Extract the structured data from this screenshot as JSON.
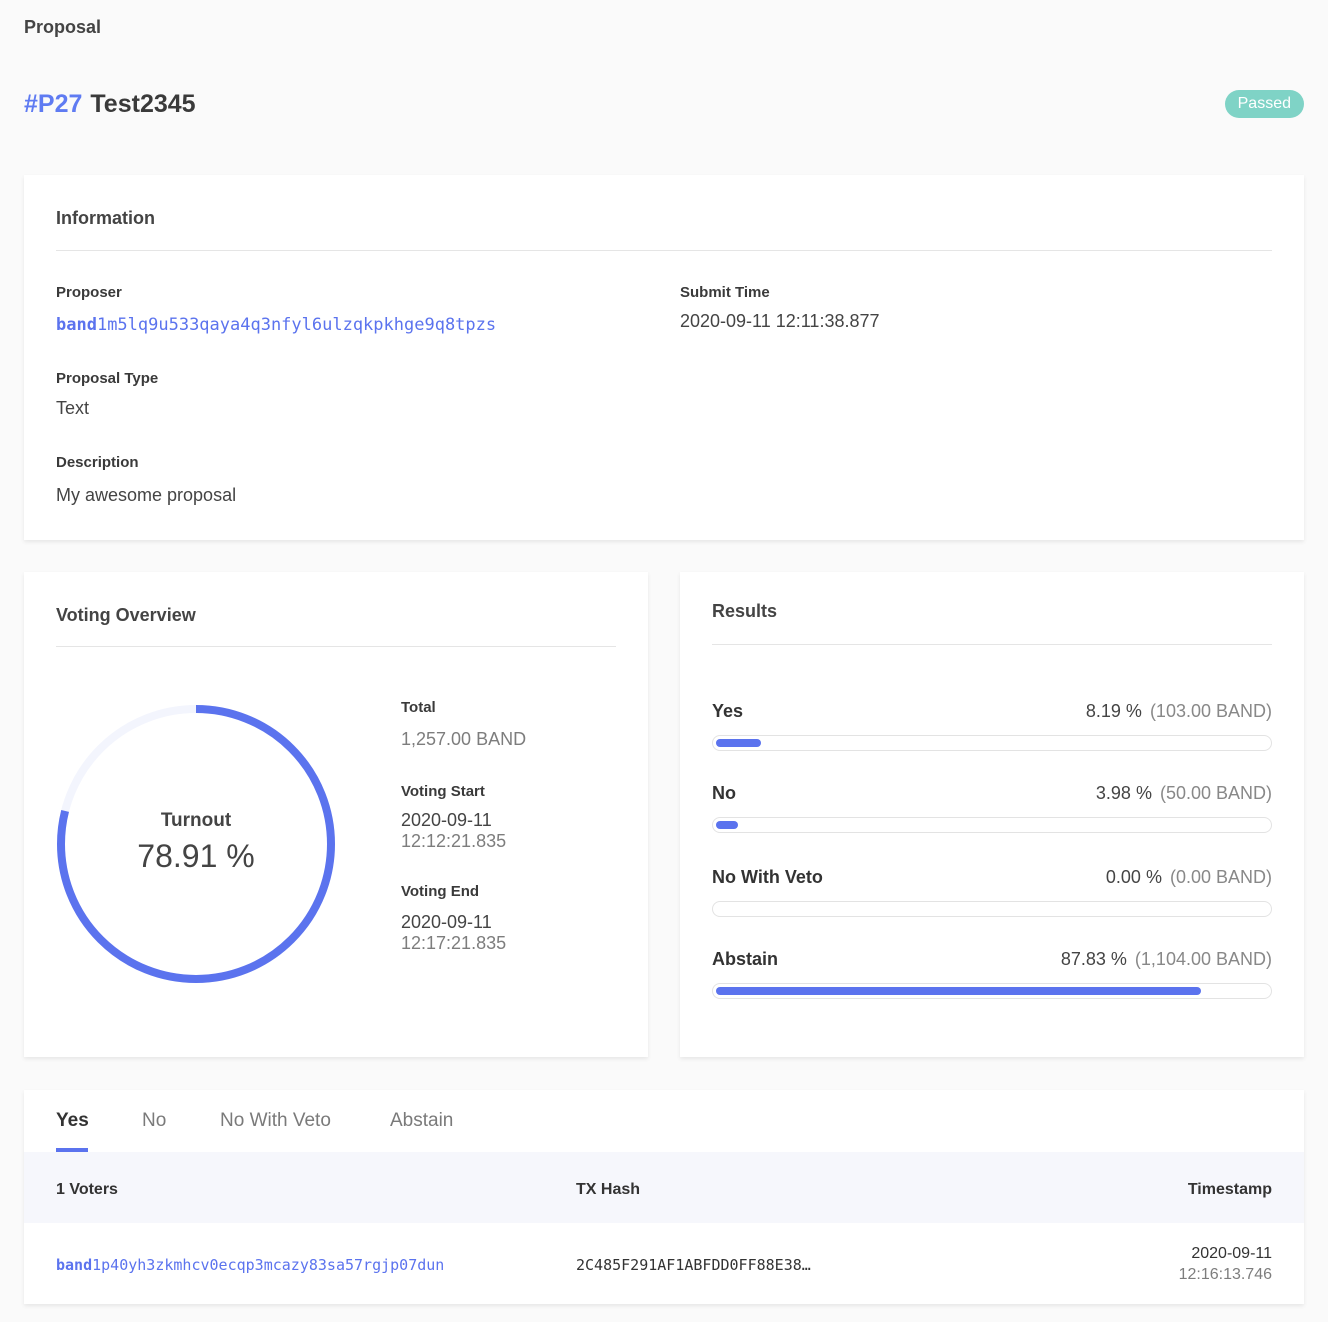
{
  "page_label": "Proposal",
  "proposal": {
    "id": "#P27",
    "name": "Test2345",
    "status": "Passed"
  },
  "information": {
    "title": "Information",
    "proposer_label": "Proposer",
    "proposer_prefix": "band",
    "proposer_rest": "1m5lq9u533qaya4q3nfyl6ulzqkpkhge9q8tpzs",
    "submit_time_label": "Submit Time",
    "submit_time": "2020-09-11 12:11:38.877",
    "proposal_type_label": "Proposal Type",
    "proposal_type": "Text",
    "description_label": "Description",
    "description": "My awesome proposal"
  },
  "voting_overview": {
    "title": "Voting Overview",
    "turnout_label": "Turnout",
    "turnout_value": "78.91 %",
    "turnout_fraction": 0.7891,
    "total_label": "Total",
    "total_value": "1,257.00 BAND",
    "voting_start_label": "Voting Start",
    "voting_start_date": "2020-09-11",
    "voting_start_time": "12:12:21.835",
    "voting_end_label": "Voting End",
    "voting_end_date": "2020-09-11",
    "voting_end_time": "12:17:21.835"
  },
  "results": {
    "title": "Results",
    "rows": [
      {
        "name": "Yes",
        "percent": "8.19 %",
        "amount": "(103.00 BAND)",
        "fraction": 0.0819
      },
      {
        "name": "No",
        "percent": "3.98 %",
        "amount": "(50.00 BAND)",
        "fraction": 0.0398
      },
      {
        "name": "No With Veto",
        "percent": "0.00 %",
        "amount": "(0.00 BAND)",
        "fraction": 0.0
      },
      {
        "name": "Abstain",
        "percent": "87.83 %",
        "amount": "(1,104.00 BAND)",
        "fraction": 0.8783
      }
    ]
  },
  "votes_table": {
    "tabs": [
      "Yes",
      "No",
      "No With Veto",
      "Abstain"
    ],
    "active_tab": "Yes",
    "headers": {
      "voters": "1 Voters",
      "tx_hash": "TX Hash",
      "timestamp": "Timestamp"
    },
    "rows": [
      {
        "voter_prefix": "band",
        "voter_rest": "1p40yh3zkmhcv0ecqp3mcazy83sa57rgjp07dun",
        "tx_hash": "2C485F291AF1ABFDD0FF88E38…",
        "date": "2020-09-11",
        "time": "12:16:13.746"
      }
    ]
  },
  "colors": {
    "accent": "#5b73ee",
    "passed_badge": "#7fd3c6",
    "ring_track": "#f3f5fd"
  }
}
